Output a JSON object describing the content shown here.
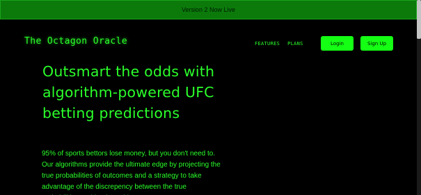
{
  "banner": {
    "text": "Version 2 Now Live"
  },
  "header": {
    "brand": "The Octagon Oracle",
    "nav": {
      "features": "FEATURES",
      "plans": "PLANS"
    },
    "login_label": "Login",
    "signup_label": "Sign Up"
  },
  "hero": {
    "title": "Outsmart the odds with algorithm-powered UFC betting predictions",
    "body": "95% of sports bettors lose money, but you don't need to. Our algorithms provide the ultimate edge by projecting the true probabilities of outcomes and a strategy to take advantage of the discrepency between the true probabilities and betting odds."
  },
  "colors": {
    "accent": "#2bff2b",
    "background": "#000000",
    "banner": "#0b7a0b"
  }
}
